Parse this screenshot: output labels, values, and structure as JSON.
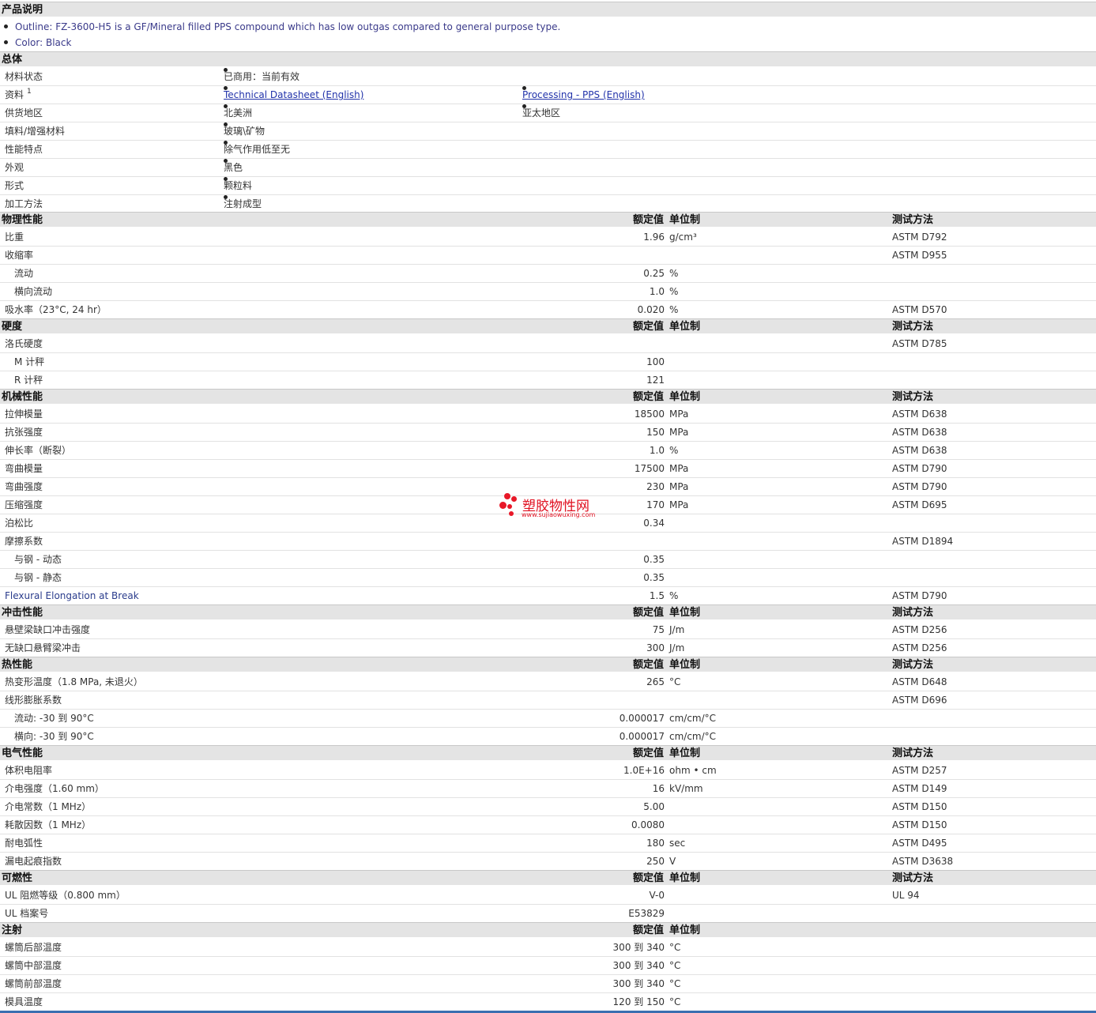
{
  "product_desc": {
    "title": "产品说明",
    "outline": "Outline: FZ-3600-H5 is a GF/Mineral filled PPS compound which has low outgas compared to general purpose type.",
    "color": "Color: Black"
  },
  "general": {
    "title": "总体",
    "rows": [
      {
        "label": "材料状态",
        "v1": "已商用：当前有效"
      },
      {
        "label": "资料",
        "sup": "1",
        "v1": "Technical Datasheet (English)",
        "v2": "Processing - PPS (English)"
      },
      {
        "label": "供货地区",
        "v1": "北美洲",
        "v2": "亚太地区"
      },
      {
        "label": "填料/增强材料",
        "v1": "玻璃\\矿物"
      },
      {
        "label": "性能特点",
        "v1": "除气作用低至无"
      },
      {
        "label": "外观",
        "v1": "黑色"
      },
      {
        "label": "形式",
        "v1": "颗粒料"
      },
      {
        "label": "加工方法",
        "v1": "注射成型"
      }
    ]
  },
  "col_headers": {
    "nominal": "额定值",
    "unit": "单位制",
    "test": "测试方法"
  },
  "physical": {
    "title": "物理性能",
    "rows": [
      {
        "label": "比重",
        "value": "1.96",
        "unit": "g/cm³",
        "test": "ASTM D792"
      },
      {
        "label": "收缩率",
        "value": "",
        "unit": "",
        "test": "ASTM D955"
      },
      {
        "label": "流动",
        "value": "0.25",
        "unit": "%",
        "test": ""
      },
      {
        "label": "横向流动",
        "value": "1.0",
        "unit": "%",
        "test": ""
      },
      {
        "label": "吸水率（23°C, 24 hr）",
        "value": "0.020",
        "unit": "%",
        "test": "ASTM D570"
      }
    ]
  },
  "hardness": {
    "title": "硬度",
    "rows": [
      {
        "label": "洛氏硬度",
        "value": "",
        "unit": "",
        "test": "ASTM D785"
      },
      {
        "label": "M 计秤",
        "value": "100",
        "unit": "",
        "test": ""
      },
      {
        "label": "R 计秤",
        "value": "121",
        "unit": "",
        "test": ""
      }
    ]
  },
  "mechanical": {
    "title": "机械性能",
    "rows": [
      {
        "label": "拉伸模量",
        "value": "18500",
        "unit": "MPa",
        "test": "ASTM D638"
      },
      {
        "label": "抗张强度",
        "value": "150",
        "unit": "MPa",
        "test": "ASTM D638"
      },
      {
        "label": "伸长率（断裂）",
        "value": "1.0",
        "unit": "%",
        "test": "ASTM D638"
      },
      {
        "label": "弯曲模量",
        "value": "17500",
        "unit": "MPa",
        "test": "ASTM D790"
      },
      {
        "label": "弯曲强度",
        "value": "230",
        "unit": "MPa",
        "test": "ASTM D790"
      },
      {
        "label": "压缩强度",
        "value": "170",
        "unit": "MPa",
        "test": "ASTM D695"
      },
      {
        "label": "泊松比",
        "value": "0.34",
        "unit": "",
        "test": ""
      },
      {
        "label": "摩擦系数",
        "value": "",
        "unit": "",
        "test": "ASTM D1894"
      },
      {
        "label": "与钢 - 动态",
        "value": "0.35",
        "unit": "",
        "test": ""
      },
      {
        "label": "与钢 - 静态",
        "value": "0.35",
        "unit": "",
        "test": ""
      },
      {
        "label": "Flexural Elongation at Break",
        "value": "1.5",
        "unit": "%",
        "test": "ASTM D790"
      }
    ]
  },
  "impact": {
    "title": "冲击性能",
    "rows": [
      {
        "label": "悬壁梁缺口冲击强度",
        "value": "75",
        "unit": "J/m",
        "test": "ASTM D256"
      },
      {
        "label": "无缺口悬臂梁冲击",
        "value": "300",
        "unit": "J/m",
        "test": "ASTM D256"
      }
    ]
  },
  "thermal": {
    "title": "热性能",
    "rows": [
      {
        "label": "热变形温度（1.8 MPa, 未退火）",
        "value": "265",
        "unit": "°C",
        "test": "ASTM D648"
      },
      {
        "label": "线形膨胀系数",
        "value": "",
        "unit": "",
        "test": "ASTM D696"
      },
      {
        "label": "流动: -30 到 90°C",
        "value": "0.000017",
        "unit": "cm/cm/°C",
        "test": ""
      },
      {
        "label": "横向: -30 到 90°C",
        "value": "0.000017",
        "unit": "cm/cm/°C",
        "test": ""
      }
    ]
  },
  "electrical": {
    "title": "电气性能",
    "rows": [
      {
        "label": "体积电阻率",
        "value": "1.0E+16",
        "unit": "ohm • cm",
        "test": "ASTM D257"
      },
      {
        "label": "介电强度（1.60 mm）",
        "value": "16",
        "unit": "kV/mm",
        "test": "ASTM D149"
      },
      {
        "label": "介电常数（1 MHz）",
        "value": "5.00",
        "unit": "",
        "test": "ASTM D150"
      },
      {
        "label": "耗散因数（1 MHz）",
        "value": "0.0080",
        "unit": "",
        "test": "ASTM D150"
      },
      {
        "label": "耐电弧性",
        "value": "180",
        "unit": "sec",
        "test": "ASTM D495"
      },
      {
        "label": "漏电起痕指数",
        "value": "250",
        "unit": "V",
        "test": "ASTM D3638"
      }
    ]
  },
  "flammability": {
    "title": "可燃性",
    "rows": [
      {
        "label": "UL 阻燃等级（0.800 mm）",
        "value": "V-0",
        "unit": "",
        "test": "UL 94"
      },
      {
        "label": "UL 档案号",
        "value": "E53829",
        "unit": "",
        "test": ""
      }
    ]
  },
  "injection": {
    "title": "注射",
    "rows": [
      {
        "label": "螺筒后部温度",
        "value": "300 到 340",
        "unit": "°C",
        "test": ""
      },
      {
        "label": "螺筒中部温度",
        "value": "300 到 340",
        "unit": "°C",
        "test": ""
      },
      {
        "label": "螺筒前部温度",
        "value": "300 到 340",
        "unit": "°C",
        "test": ""
      },
      {
        "label": "模具温度",
        "value": "120 到 150",
        "unit": "°C",
        "test": ""
      }
    ]
  },
  "watermark": {
    "brand": "塑胶物性网",
    "url": "www.sujiaowuxing.com"
  }
}
